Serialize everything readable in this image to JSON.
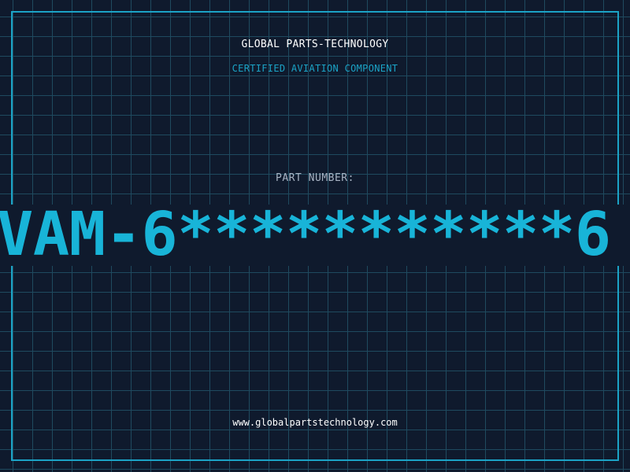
{
  "header": {
    "company": "GLOBAL PARTS-TECHNOLOGY",
    "certification": "CERTIFIED AVIATION COMPONENT"
  },
  "part": {
    "label": "PART NUMBER:",
    "value": "VAM-6***********6"
  },
  "footer": {
    "website": "www.globalpartstechnology.com"
  },
  "colors": {
    "background": "#0f1a2d",
    "grid": "#1f4a5f",
    "accent": "#1ba3c6",
    "part_number": "#18b4d8",
    "label": "#a8b4c4",
    "text": "#ffffff"
  }
}
